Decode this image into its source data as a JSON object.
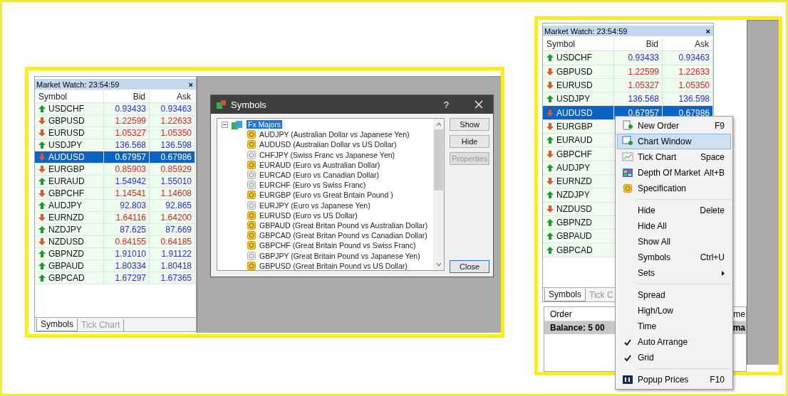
{
  "left_window": {
    "market_watch": {
      "title": "Market Watch: 23:54:59",
      "close": "×",
      "columns": [
        "Symbol",
        "Bid",
        "Ask"
      ],
      "rows": [
        {
          "symbol": "USDCHF",
          "rising": true,
          "bid": "0.93433",
          "ask": "0.93463",
          "selected": false
        },
        {
          "symbol": "GBPUSD",
          "rising": false,
          "bid": "1.22599",
          "ask": "1.22633",
          "selected": false
        },
        {
          "symbol": "EURUSD",
          "rising": false,
          "bid": "1.05327",
          "ask": "1.05350",
          "selected": false
        },
        {
          "symbol": "USDJPY",
          "rising": true,
          "bid": "136.568",
          "ask": "136.598",
          "selected": false
        },
        {
          "symbol": "AUDUSD",
          "rising": false,
          "bid": "0.67957",
          "ask": "0.67986",
          "selected": true
        },
        {
          "symbol": "EURGBP",
          "rising": false,
          "bid": "0.85903",
          "ask": "0.85929",
          "selected": false
        },
        {
          "symbol": "EURAUD",
          "rising": true,
          "bid": "1.54942",
          "ask": "1.55010",
          "selected": false
        },
        {
          "symbol": "GBPCHF",
          "rising": false,
          "bid": "1.14541",
          "ask": "1.14608",
          "selected": false
        },
        {
          "symbol": "AUDJPY",
          "rising": true,
          "bid": "92.803",
          "ask": "92.865",
          "selected": false
        },
        {
          "symbol": "EURNZD",
          "rising": false,
          "bid": "1.64116",
          "ask": "1.64200",
          "selected": false
        },
        {
          "symbol": "NZDJPY",
          "rising": true,
          "bid": "87.625",
          "ask": "87.669",
          "selected": false
        },
        {
          "symbol": "NZDUSD",
          "rising": false,
          "bid": "0.64155",
          "ask": "0.64185",
          "selected": false
        },
        {
          "symbol": "GBPNZD",
          "rising": true,
          "bid": "1.91010",
          "ask": "1.91122",
          "selected": false
        },
        {
          "symbol": "GBPAUD",
          "rising": true,
          "bid": "1.80334",
          "ask": "1.80418",
          "selected": false
        },
        {
          "symbol": "GBPCAD",
          "rising": true,
          "bid": "1.67297",
          "ask": "1.67365",
          "selected": false
        }
      ],
      "tabs": [
        {
          "label": "Symbols",
          "selected": true
        },
        {
          "label": "Tick Chart",
          "selected": false
        }
      ]
    },
    "symbols_dialog": {
      "title": "Symbols",
      "help": "?",
      "group": {
        "label": "Fx Majors",
        "selected": true,
        "expanded": true
      },
      "items": [
        {
          "label": "AUDJPY  (Australian Dollar vs Japanese Yen)",
          "shown": true
        },
        {
          "label": "AUDUSD  (Australian Dollar vs US Dollar)",
          "shown": true
        },
        {
          "label": "CHFJPY  (Swiss Franc vs Japanese Yen)",
          "shown": false
        },
        {
          "label": "EURAUD  (Euro vs Australian Dollar)",
          "shown": true
        },
        {
          "label": "EURCAD  (Euro vs Canadian Dollar)",
          "shown": false
        },
        {
          "label": "EURCHF  (Euro vs Swiss Franc)",
          "shown": false
        },
        {
          "label": "EURGBP  (Euro vs Great Britain Pound )",
          "shown": true
        },
        {
          "label": "EURJPY  (Euro vs Japanese Yen)",
          "shown": false
        },
        {
          "label": "EURUSD  (Euro vs US Dollar)",
          "shown": true
        },
        {
          "label": "GBPAUD  (Great Britan Pound vs Australian Dollar)",
          "shown": true
        },
        {
          "label": "GBPCAD  (Great Britan Pound vs Canadian Dollar)",
          "shown": true
        },
        {
          "label": "GBPCHF  (Great Britain Pound vs Swiss Franc)",
          "shown": true
        },
        {
          "label": "GBPJPY  (Great Britain Pound vs Japanese Yen)",
          "shown": false
        },
        {
          "label": "GBPUSD  (Great Britain Pound vs US Dollar)",
          "shown": true
        }
      ],
      "buttons": [
        {
          "label": "Show",
          "disabled": false,
          "default": false
        },
        {
          "label": "Hide",
          "disabled": false,
          "default": false
        },
        {
          "label": "Properties",
          "disabled": true,
          "default": false
        },
        {
          "label": "Close",
          "disabled": false,
          "default": true
        }
      ]
    }
  },
  "right_window": {
    "market_watch": {
      "title": "Market Watch: 23:54:59",
      "close": "×",
      "columns": [
        "Symbol",
        "Bid",
        "Ask"
      ],
      "rows": [
        {
          "symbol": "USDCHF",
          "rising": true,
          "bid": "0.93433",
          "ask": "0.93463",
          "selected": false
        },
        {
          "symbol": "GBPUSD",
          "rising": false,
          "bid": "1.22599",
          "ask": "1.22633",
          "selected": false
        },
        {
          "symbol": "EURUSD",
          "rising": false,
          "bid": "1.05327",
          "ask": "1.05350",
          "selected": false
        },
        {
          "symbol": "USDJPY",
          "rising": true,
          "bid": "136.568",
          "ask": "136.598",
          "selected": false
        },
        {
          "symbol": "AUDUSD",
          "rising": false,
          "bid": "0.67957",
          "ask": "0.67986",
          "selected": true
        },
        {
          "symbol": "EURGBP",
          "rising": false,
          "selected": false
        },
        {
          "symbol": "EURAUD",
          "rising": true,
          "selected": false
        },
        {
          "symbol": "GBPCHF",
          "rising": false,
          "selected": false
        },
        {
          "symbol": "AUDJPY",
          "rising": true,
          "selected": false
        },
        {
          "symbol": "EURNZD",
          "rising": false,
          "selected": false
        },
        {
          "symbol": "NZDJPY",
          "rising": true,
          "selected": false
        },
        {
          "symbol": "NZDUSD",
          "rising": false,
          "selected": false
        },
        {
          "symbol": "GBPNZD",
          "rising": true,
          "selected": false
        },
        {
          "symbol": "GBPAUD",
          "rising": true,
          "selected": false
        },
        {
          "symbol": "GBPCAD",
          "rising": true,
          "selected": false
        }
      ],
      "tabs": [
        {
          "label": "Symbols",
          "selected": true
        },
        {
          "label": "Tick C",
          "selected": false
        }
      ]
    },
    "terminal": {
      "columns": [
        "Order",
        "me"
      ],
      "balance_row": {
        "text": "Balance: 5 00",
        "cell_2": "ma"
      }
    },
    "context_menu": [
      {
        "kind": "item",
        "label": "New Order",
        "shortcut": "F9",
        "selected": false,
        "checked": false
      },
      {
        "kind": "item",
        "label": "Chart Window",
        "selected": true,
        "checked": false
      },
      {
        "kind": "item",
        "label": "Tick Chart",
        "shortcut": "Space",
        "selected": false,
        "checked": false
      },
      {
        "kind": "item",
        "label": "Depth Of Market",
        "shortcut": "Alt+B",
        "selected": false,
        "checked": false
      },
      {
        "kind": "item",
        "label": "Specification",
        "selected": false,
        "checked": false
      },
      {
        "kind": "separator"
      },
      {
        "kind": "item",
        "label": "Hide",
        "shortcut": "Delete",
        "selected": false,
        "checked": false
      },
      {
        "kind": "item",
        "label": "Hide All",
        "selected": false,
        "checked": false
      },
      {
        "kind": "item",
        "label": "Show All",
        "selected": false,
        "checked": false
      },
      {
        "kind": "item",
        "label": "Symbols",
        "shortcut": "Ctrl+U",
        "selected": false,
        "checked": false
      },
      {
        "kind": "item",
        "label": "Sets",
        "submenu": true,
        "selected": false,
        "checked": false
      },
      {
        "kind": "separator"
      },
      {
        "kind": "item",
        "label": "Spread",
        "selected": false,
        "checked": false
      },
      {
        "kind": "item",
        "label": "High/Low",
        "selected": false,
        "checked": false
      },
      {
        "kind": "item",
        "label": "Time",
        "selected": false,
        "checked": false
      },
      {
        "kind": "item",
        "label": "Auto Arrange",
        "selected": false,
        "checked": true
      },
      {
        "kind": "item",
        "label": "Grid",
        "selected": false,
        "checked": true
      },
      {
        "kind": "separator"
      },
      {
        "kind": "item",
        "label": "Popup Prices",
        "shortcut": "F10",
        "selected": false,
        "checked": false
      }
    ]
  }
}
